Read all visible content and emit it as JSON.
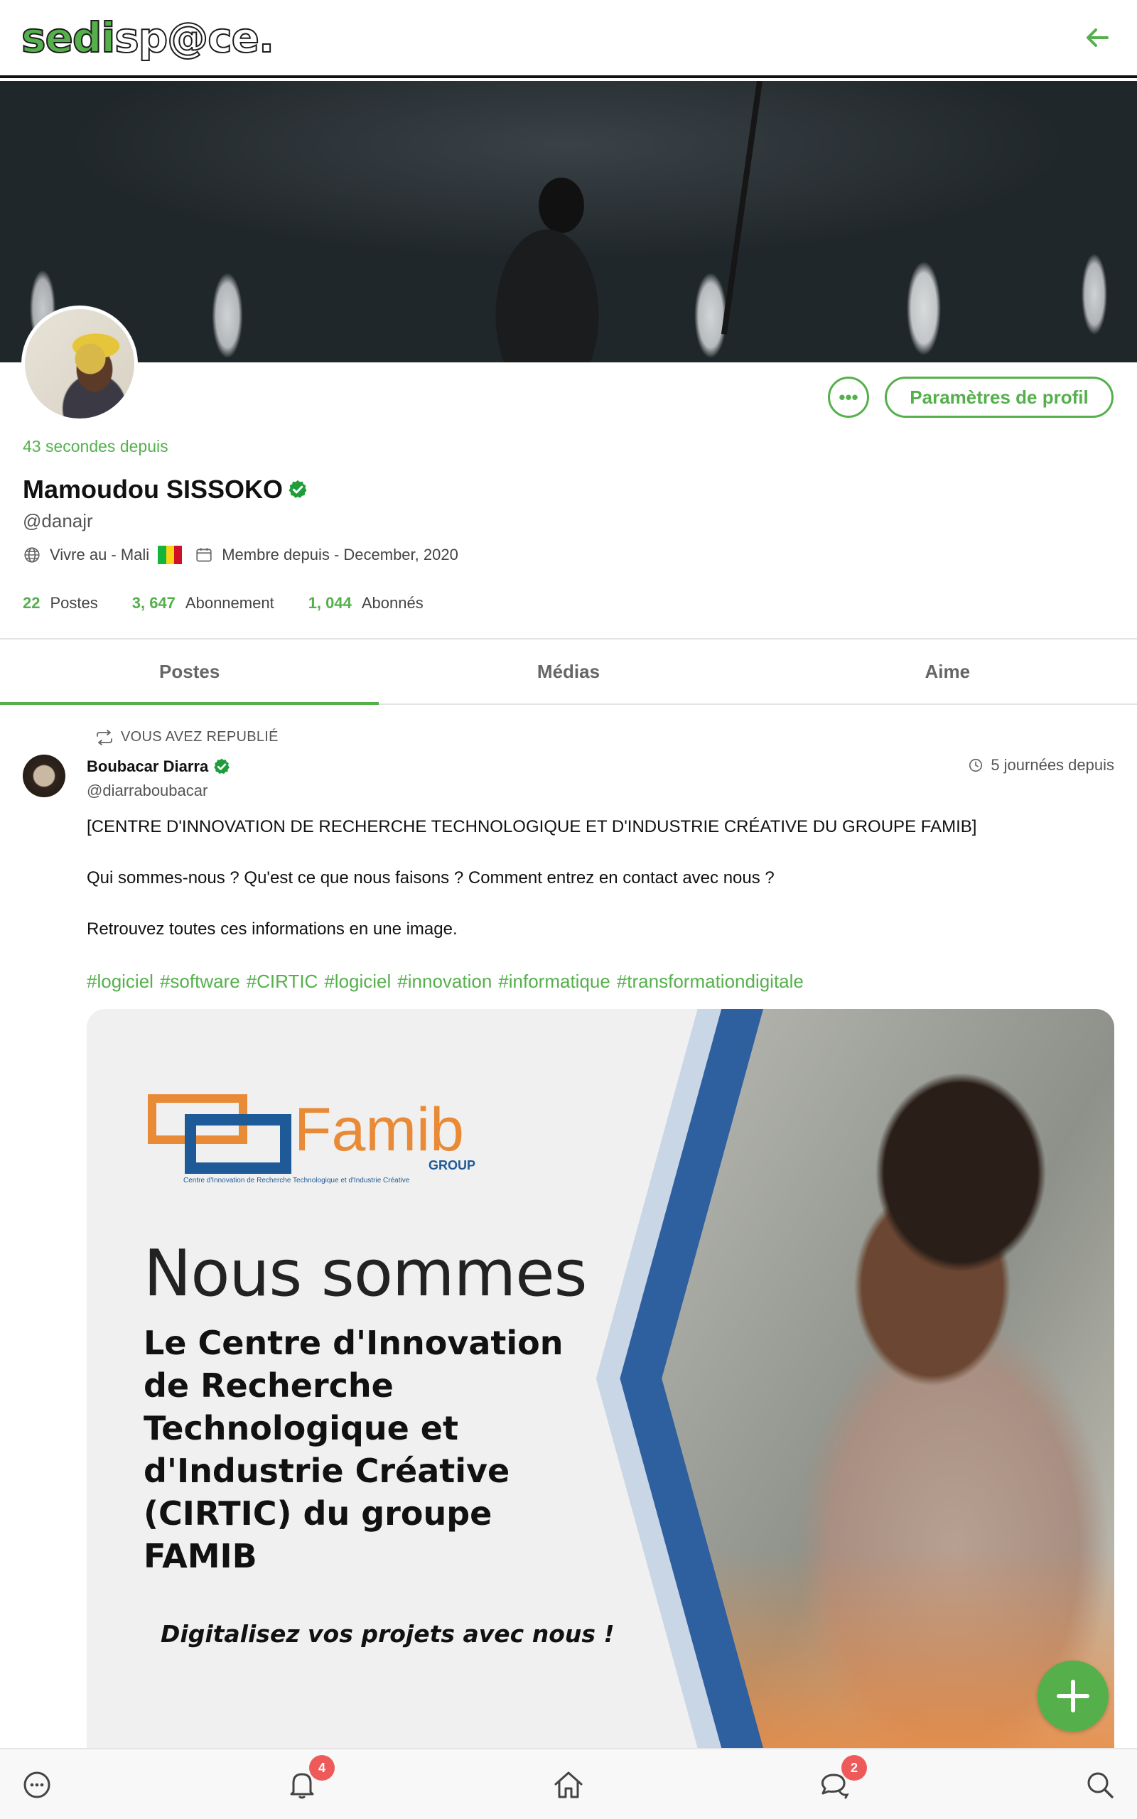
{
  "header": {
    "logo_part1": "sedi",
    "logo_part2": "sp@ce.",
    "back_icon": "arrow-left-icon"
  },
  "profile": {
    "last_seen": "43 secondes depuis",
    "name": "Mamoudou SISSOKO",
    "verified_icon": "verified-badge-icon",
    "handle": "@danajr",
    "location": "Vivre au - Mali",
    "member_since": "Membre depuis - December, 2020",
    "more_button_icon": "ellipsis-icon",
    "settings_button": "Paramètres de profil",
    "stats": {
      "posts_count": "22",
      "posts_label": "Postes",
      "following_count": "3, 647",
      "following_label": "Abonnement",
      "followers_count": "1, 044",
      "followers_label": "Abonnés"
    }
  },
  "tabs": [
    {
      "label": "Postes",
      "active": true
    },
    {
      "label": "Médias",
      "active": false
    },
    {
      "label": "Aime",
      "active": false
    }
  ],
  "post": {
    "repost_label": "VOUS AVEZ REPUBLIÉ",
    "author_name": "Boubacar Diarra",
    "author_handle": "@diarraboubacar",
    "time": "5 journées depuis",
    "paragraphs": [
      "[CENTRE D'INNOVATION DE RECHERCHE TECHNOLOGIQUE ET D'INDUSTRIE CRÉATIVE DU GROUPE FAMIB]",
      "Qui sommes-nous ? Qu'est ce que nous faisons ? Comment entrez en contact avec nous ?",
      "Retrouvez toutes ces informations en une image."
    ],
    "hashtags": [
      "#logiciel",
      "#software",
      "#CIRTIC",
      "#logiciel",
      "#innovation",
      "#informatique",
      "#transformationdigitale"
    ],
    "image": {
      "brand": "Famib",
      "brand_sub": "GROUP",
      "brand_tagline": "Centre d'Innovation de Recherche Technologique et d'Industrie Créative",
      "headline": "Nous sommes",
      "description_lines": [
        "Le Centre d'Innovation",
        "de Recherche",
        "Technologique et",
        "d'Industrie Créative",
        "(CIRTIC) du groupe FAMIB"
      ],
      "cta": "Digitalisez vos projets avec nous !"
    }
  },
  "bottom_nav": {
    "items": [
      {
        "icon": "chat-bubble-icon"
      },
      {
        "icon": "bell-icon",
        "badge": "4"
      },
      {
        "icon": "home-icon"
      },
      {
        "icon": "messages-icon",
        "badge": "2"
      },
      {
        "icon": "search-icon"
      }
    ]
  },
  "fab_icon": "plus-icon",
  "colors": {
    "accent": "#55b04c",
    "badge": "#ee5a5a",
    "famib_orange": "#e98a36",
    "famib_blue": "#1f5a98"
  }
}
